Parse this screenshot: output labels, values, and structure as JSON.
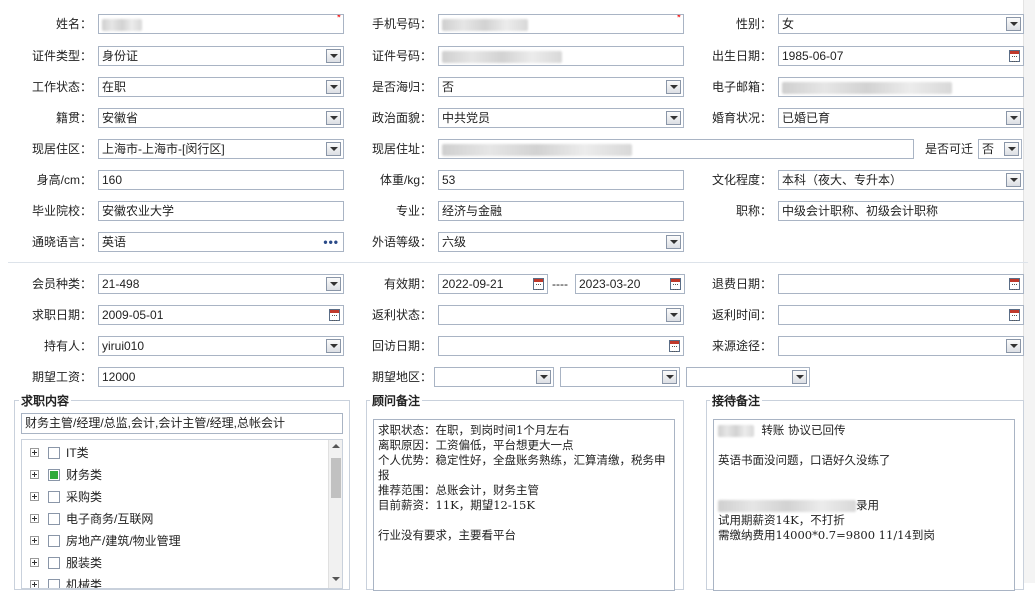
{
  "row1": {
    "name_label": "姓名：",
    "phone_label": "手机号码：",
    "gender_label": "性别：",
    "gender_value": "女"
  },
  "row2": {
    "id_type_label": "证件类型：",
    "id_type_value": "身份证",
    "id_no_label": "证件号码：",
    "birth_label": "出生日期：",
    "birth_value": "1985-06-07"
  },
  "row3": {
    "work_label": "工作状态：",
    "work_value": "在职",
    "overseas_label": "是否海归：",
    "overseas_value": "否",
    "email_label": "电子邮箱："
  },
  "row4": {
    "native_label": "籍贯：",
    "native_value": "安徽省",
    "political_label": "政治面貌：",
    "political_value": "中共党员",
    "marital_label": "婚育状况：",
    "marital_value": "已婚已育"
  },
  "row5": {
    "district_label": "现居住区：",
    "district_value": "上海市-上海市-[闵行区]",
    "address_label": "现居住址：",
    "relocate_label": "是否可迁",
    "relocate_value": "否"
  },
  "row6": {
    "height_label": "身高/cm：",
    "height_value": "160",
    "weight_label": "体重/kg：",
    "weight_value": "53",
    "edu_label": "文化程度：",
    "edu_value": "本科（夜大、专升本）"
  },
  "row7": {
    "school_label": "毕业院校：",
    "school_value": "安徽农业大学",
    "major_label": "专业：",
    "major_value": "经济与金融",
    "title_label": "职称：",
    "title_value": "中级会计职称、初级会计职称"
  },
  "row8": {
    "language_label": "通晓语言：",
    "language_value": "英语",
    "lang_level_label": "外语等级：",
    "lang_level_value": "六级"
  },
  "row9": {
    "member_label": "会员种类：",
    "member_value": "21-498",
    "valid_label": "有效期：",
    "valid_from": "2022-09-21",
    "valid_sep": "----",
    "valid_to": "2023-03-20",
    "refund_label": "退费日期："
  },
  "row10": {
    "jobdate_label": "求职日期：",
    "jobdate_value": "2009-05-01",
    "rebate_status_label": "返利状态：",
    "rebate_time_label": "返利时间："
  },
  "row11": {
    "holder_label": "持有人：",
    "holder_value": "yirui010",
    "visit_label": "回访日期：",
    "source_label": "来源途径："
  },
  "row12": {
    "salary_label": "期望工资：",
    "salary_value": "12000",
    "region_label": "期望地区："
  },
  "job_panel": {
    "title": "求职内容",
    "summary": "财务主管/经理/总监,会计,会计主管/经理,总帐会计",
    "tree": [
      {
        "label": "IT类",
        "checked": false
      },
      {
        "label": "财务类",
        "checked": true
      },
      {
        "label": "采购类",
        "checked": false
      },
      {
        "label": "电子商务/互联网",
        "checked": false
      },
      {
        "label": "房地产/建筑/物业管理",
        "checked": false
      },
      {
        "label": "服装类",
        "checked": false
      },
      {
        "label": "机械类",
        "checked": false
      }
    ]
  },
  "advisor_panel": {
    "title": "顾问备注",
    "text": "求职状态：在职，到岗时间1个月左右\n离职原因：工资偏低，平台想更大一点\n个人优势：稳定性好，全盘账务熟练，汇算清缴，税务申报\n推荐范围：总账会计，财务主管\n目前薪资：11K，期望12-15K\n\n行业没有要求，主要看平台"
  },
  "reception_panel": {
    "title": "接待备注",
    "line1": "转账  协议已回传",
    "line2": "英语书面没问题，口语好久没练了",
    "line3_suffix": "录用",
    "line4": "试用期薪资14K，不打折",
    "line5": "需缴纳费用14000*0.7=9800  11/14到岗"
  }
}
